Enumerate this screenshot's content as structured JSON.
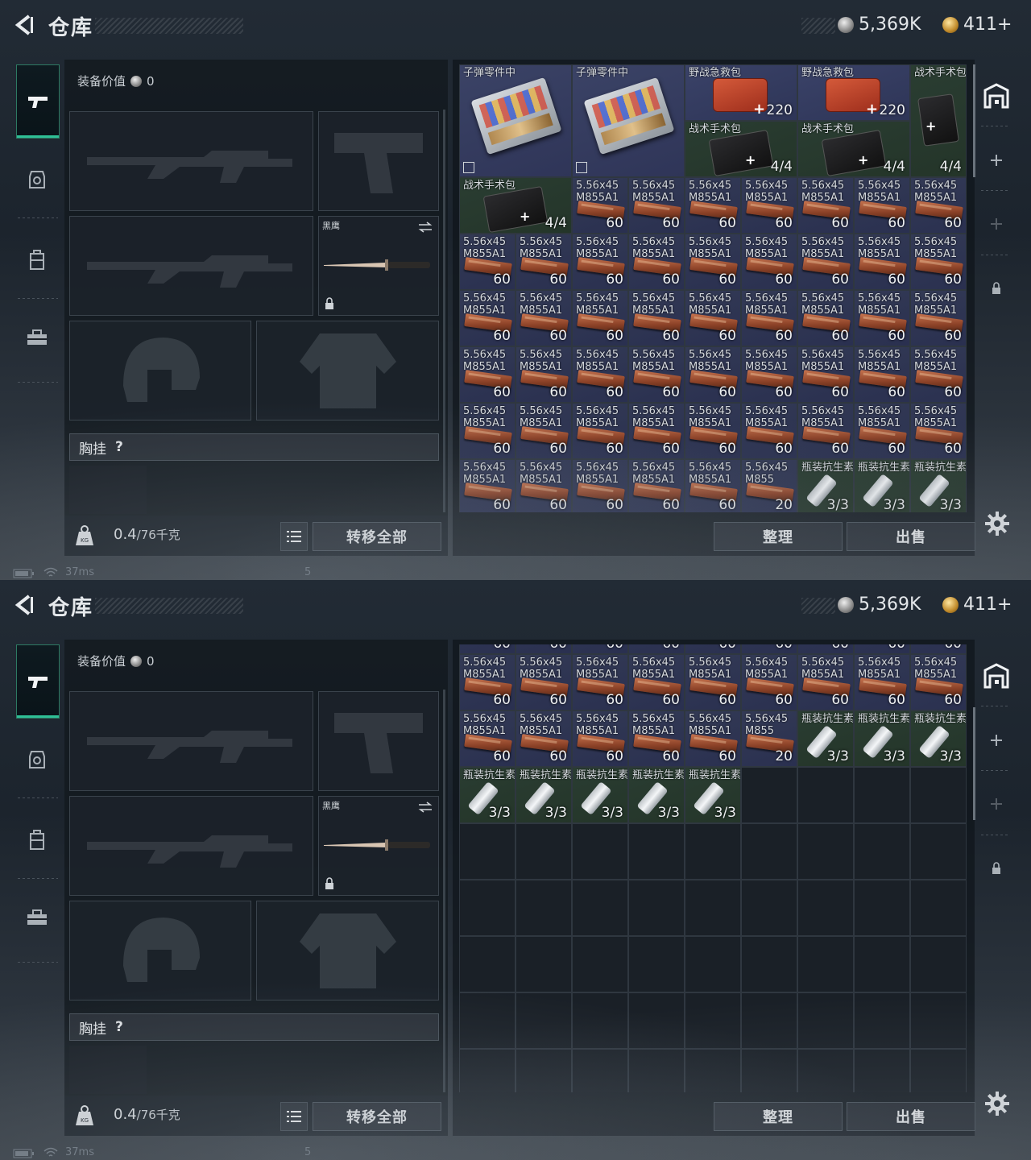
{
  "screens": [
    {
      "topbar": {
        "title": "仓库",
        "silver": "5,369K",
        "gold": "411+",
        "gold_plus": "+"
      },
      "equipment": {
        "value_label": "装备价值",
        "value": "0",
        "knife_label": "黑鹰",
        "chest_label": "胸挂",
        "help": "?"
      },
      "weight": {
        "current": "0.4",
        "max": "/76千克"
      },
      "buttons": {
        "transfer_all": "转移全部",
        "sort": "整理",
        "sell": "出售"
      },
      "status": {
        "ping": "37ms",
        "num": "5"
      },
      "grid": {
        "items": [
          {
            "c": 0,
            "r": 0,
            "w": 2,
            "h": 2,
            "type": "ammobox",
            "name": "子弹零件中",
            "count": ""
          },
          {
            "c": 2,
            "r": 0,
            "w": 2,
            "h": 2,
            "type": "ammobox",
            "name": "子弹零件中",
            "count": ""
          },
          {
            "c": 4,
            "r": 0,
            "w": 2,
            "h": 1,
            "type": "redkit",
            "name": "野战急救包",
            "count": "220"
          },
          {
            "c": 6,
            "r": 0,
            "w": 2,
            "h": 1,
            "type": "redkit",
            "name": "野战急救包",
            "count": "220"
          },
          {
            "c": 8,
            "r": 0,
            "w": 1,
            "h": 2,
            "type": "blackkit",
            "name": "战术手术包",
            "count": "4/4"
          },
          {
            "c": 4,
            "r": 1,
            "w": 2,
            "h": 1,
            "type": "blackkit",
            "name": "战术手术包",
            "count": "4/4"
          },
          {
            "c": 6,
            "r": 1,
            "w": 2,
            "h": 1,
            "type": "blackkit",
            "name": "战术手术包",
            "count": "4/4"
          },
          {
            "c": 0,
            "r": 2,
            "w": 2,
            "h": 1,
            "type": "blackkit",
            "name": "战术手术包",
            "count": "4/4"
          },
          {
            "c": 2,
            "r": 2,
            "w": 1,
            "h": 1,
            "type": "ammo",
            "name": "5.56x45\nM855A1",
            "count": "60"
          },
          {
            "c": 3,
            "r": 2,
            "w": 1,
            "h": 1,
            "type": "ammo",
            "name": "5.56x45\nM855A1",
            "count": "60"
          },
          {
            "c": 4,
            "r": 2,
            "w": 1,
            "h": 1,
            "type": "ammo",
            "name": "5.56x45\nM855A1",
            "count": "60"
          },
          {
            "c": 5,
            "r": 2,
            "w": 1,
            "h": 1,
            "type": "ammo",
            "name": "5.56x45\nM855A1",
            "count": "60"
          },
          {
            "c": 6,
            "r": 2,
            "w": 1,
            "h": 1,
            "type": "ammo",
            "name": "5.56x45\nM855A1",
            "count": "60"
          },
          {
            "c": 7,
            "r": 2,
            "w": 1,
            "h": 1,
            "type": "ammo",
            "name": "5.56x45\nM855A1",
            "count": "60"
          },
          {
            "c": 8,
            "r": 2,
            "w": 1,
            "h": 1,
            "type": "ammo",
            "name": "5.56x45\nM855A1",
            "count": "60"
          },
          {
            "c": 0,
            "r": 3,
            "w": 1,
            "h": 1,
            "type": "ammo",
            "name": "5.56x45\nM855A1",
            "count": "60"
          },
          {
            "c": 1,
            "r": 3,
            "w": 1,
            "h": 1,
            "type": "ammo",
            "name": "5.56x45\nM855A1",
            "count": "60"
          },
          {
            "c": 2,
            "r": 3,
            "w": 1,
            "h": 1,
            "type": "ammo",
            "name": "5.56x45\nM855A1",
            "count": "60"
          },
          {
            "c": 3,
            "r": 3,
            "w": 1,
            "h": 1,
            "type": "ammo",
            "name": "5.56x45\nM855A1",
            "count": "60"
          },
          {
            "c": 4,
            "r": 3,
            "w": 1,
            "h": 1,
            "type": "ammo",
            "name": "5.56x45\nM855A1",
            "count": "60"
          },
          {
            "c": 5,
            "r": 3,
            "w": 1,
            "h": 1,
            "type": "ammo",
            "name": "5.56x45\nM855A1",
            "count": "60"
          },
          {
            "c": 6,
            "r": 3,
            "w": 1,
            "h": 1,
            "type": "ammo",
            "name": "5.56x45\nM855A1",
            "count": "60"
          },
          {
            "c": 7,
            "r": 3,
            "w": 1,
            "h": 1,
            "type": "ammo",
            "name": "5.56x45\nM855A1",
            "count": "60"
          },
          {
            "c": 8,
            "r": 3,
            "w": 1,
            "h": 1,
            "type": "ammo",
            "name": "5.56x45\nM855A1",
            "count": "60"
          },
          {
            "c": 0,
            "r": 4,
            "w": 1,
            "h": 1,
            "type": "ammo",
            "name": "5.56x45\nM855A1",
            "count": "60"
          },
          {
            "c": 1,
            "r": 4,
            "w": 1,
            "h": 1,
            "type": "ammo",
            "name": "5.56x45\nM855A1",
            "count": "60"
          },
          {
            "c": 2,
            "r": 4,
            "w": 1,
            "h": 1,
            "type": "ammo",
            "name": "5.56x45\nM855A1",
            "count": "60"
          },
          {
            "c": 3,
            "r": 4,
            "w": 1,
            "h": 1,
            "type": "ammo",
            "name": "5.56x45\nM855A1",
            "count": "60"
          },
          {
            "c": 4,
            "r": 4,
            "w": 1,
            "h": 1,
            "type": "ammo",
            "name": "5.56x45\nM855A1",
            "count": "60"
          },
          {
            "c": 5,
            "r": 4,
            "w": 1,
            "h": 1,
            "type": "ammo",
            "name": "5.56x45\nM855A1",
            "count": "60"
          },
          {
            "c": 6,
            "r": 4,
            "w": 1,
            "h": 1,
            "type": "ammo",
            "name": "5.56x45\nM855A1",
            "count": "60"
          },
          {
            "c": 7,
            "r": 4,
            "w": 1,
            "h": 1,
            "type": "ammo",
            "name": "5.56x45\nM855A1",
            "count": "60"
          },
          {
            "c": 8,
            "r": 4,
            "w": 1,
            "h": 1,
            "type": "ammo",
            "name": "5.56x45\nM855A1",
            "count": "60"
          },
          {
            "c": 0,
            "r": 5,
            "w": 1,
            "h": 1,
            "type": "ammo",
            "name": "5.56x45\nM855A1",
            "count": "60"
          },
          {
            "c": 1,
            "r": 5,
            "w": 1,
            "h": 1,
            "type": "ammo",
            "name": "5.56x45\nM855A1",
            "count": "60"
          },
          {
            "c": 2,
            "r": 5,
            "w": 1,
            "h": 1,
            "type": "ammo",
            "name": "5.56x45\nM855A1",
            "count": "60"
          },
          {
            "c": 3,
            "r": 5,
            "w": 1,
            "h": 1,
            "type": "ammo",
            "name": "5.56x45\nM855A1",
            "count": "60"
          },
          {
            "c": 4,
            "r": 5,
            "w": 1,
            "h": 1,
            "type": "ammo",
            "name": "5.56x45\nM855A1",
            "count": "60"
          },
          {
            "c": 5,
            "r": 5,
            "w": 1,
            "h": 1,
            "type": "ammo",
            "name": "5.56x45\nM855A1",
            "count": "60"
          },
          {
            "c": 6,
            "r": 5,
            "w": 1,
            "h": 1,
            "type": "ammo",
            "name": "5.56x45\nM855A1",
            "count": "60"
          },
          {
            "c": 7,
            "r": 5,
            "w": 1,
            "h": 1,
            "type": "ammo",
            "name": "5.56x45\nM855A1",
            "count": "60"
          },
          {
            "c": 8,
            "r": 5,
            "w": 1,
            "h": 1,
            "type": "ammo",
            "name": "5.56x45\nM855A1",
            "count": "60"
          },
          {
            "c": 0,
            "r": 6,
            "w": 1,
            "h": 1,
            "type": "ammo",
            "name": "5.56x45\nM855A1",
            "count": "60"
          },
          {
            "c": 1,
            "r": 6,
            "w": 1,
            "h": 1,
            "type": "ammo",
            "name": "5.56x45\nM855A1",
            "count": "60"
          },
          {
            "c": 2,
            "r": 6,
            "w": 1,
            "h": 1,
            "type": "ammo",
            "name": "5.56x45\nM855A1",
            "count": "60"
          },
          {
            "c": 3,
            "r": 6,
            "w": 1,
            "h": 1,
            "type": "ammo",
            "name": "5.56x45\nM855A1",
            "count": "60"
          },
          {
            "c": 4,
            "r": 6,
            "w": 1,
            "h": 1,
            "type": "ammo",
            "name": "5.56x45\nM855A1",
            "count": "60"
          },
          {
            "c": 5,
            "r": 6,
            "w": 1,
            "h": 1,
            "type": "ammo",
            "name": "5.56x45\nM855A1",
            "count": "60"
          },
          {
            "c": 6,
            "r": 6,
            "w": 1,
            "h": 1,
            "type": "ammo",
            "name": "5.56x45\nM855A1",
            "count": "60"
          },
          {
            "c": 7,
            "r": 6,
            "w": 1,
            "h": 1,
            "type": "ammo",
            "name": "5.56x45\nM855A1",
            "count": "60"
          },
          {
            "c": 8,
            "r": 6,
            "w": 1,
            "h": 1,
            "type": "ammo",
            "name": "5.56x45\nM855A1",
            "count": "60"
          },
          {
            "c": 0,
            "r": 7,
            "w": 1,
            "h": 1,
            "type": "ammo",
            "name": "5.56x45\nM855A1",
            "count": "60"
          },
          {
            "c": 1,
            "r": 7,
            "w": 1,
            "h": 1,
            "type": "ammo",
            "name": "5.56x45\nM855A1",
            "count": "60"
          },
          {
            "c": 2,
            "r": 7,
            "w": 1,
            "h": 1,
            "type": "ammo",
            "name": "5.56x45\nM855A1",
            "count": "60"
          },
          {
            "c": 3,
            "r": 7,
            "w": 1,
            "h": 1,
            "type": "ammo",
            "name": "5.56x45\nM855A1",
            "count": "60"
          },
          {
            "c": 4,
            "r": 7,
            "w": 1,
            "h": 1,
            "type": "ammo",
            "name": "5.56x45\nM855A1",
            "count": "60"
          },
          {
            "c": 5,
            "r": 7,
            "w": 1,
            "h": 1,
            "type": "ammoalt",
            "name": "5.56x45\nM855",
            "count": "20"
          },
          {
            "c": 6,
            "r": 7,
            "w": 1,
            "h": 1,
            "type": "vial",
            "name": "瓶装抗生素",
            "count": "3/3"
          },
          {
            "c": 7,
            "r": 7,
            "w": 1,
            "h": 1,
            "type": "vial",
            "name": "瓶装抗生素",
            "count": "3/3"
          },
          {
            "c": 8,
            "r": 7,
            "w": 1,
            "h": 1,
            "type": "vial",
            "name": "瓶装抗生素",
            "count": "3/3"
          }
        ]
      }
    },
    {
      "topbar": {
        "title": "仓库",
        "silver": "5,369K",
        "gold": "411+",
        "gold_plus": "+"
      },
      "equipment": {
        "value_label": "装备价值",
        "value": "0",
        "knife_label": "黑鹰",
        "chest_label": "胸挂",
        "help": "?"
      },
      "weight": {
        "current": "0.4",
        "max": "/76千克"
      },
      "buttons": {
        "transfer_all": "转移全部",
        "sort": "整理",
        "sell": "出售"
      },
      "status": {
        "ping": "37ms",
        "num": "5"
      },
      "grid": {
        "items": [
          {
            "c": 0,
            "r": -1,
            "w": 1,
            "h": 1,
            "type": "ammo",
            "name": "",
            "count": "60"
          },
          {
            "c": 1,
            "r": -1,
            "w": 1,
            "h": 1,
            "type": "ammo",
            "name": "",
            "count": "60"
          },
          {
            "c": 2,
            "r": -1,
            "w": 1,
            "h": 1,
            "type": "ammo",
            "name": "",
            "count": "60"
          },
          {
            "c": 3,
            "r": -1,
            "w": 1,
            "h": 1,
            "type": "ammo",
            "name": "",
            "count": "60"
          },
          {
            "c": 4,
            "r": -1,
            "w": 1,
            "h": 1,
            "type": "ammo",
            "name": "",
            "count": "60"
          },
          {
            "c": 5,
            "r": -1,
            "w": 1,
            "h": 1,
            "type": "ammo",
            "name": "",
            "count": "60"
          },
          {
            "c": 6,
            "r": -1,
            "w": 1,
            "h": 1,
            "type": "ammo",
            "name": "",
            "count": "60"
          },
          {
            "c": 7,
            "r": -1,
            "w": 1,
            "h": 1,
            "type": "ammo",
            "name": "",
            "count": "60"
          },
          {
            "c": 8,
            "r": -1,
            "w": 1,
            "h": 1,
            "type": "ammo",
            "name": "",
            "count": "60"
          },
          {
            "c": 0,
            "r": 0,
            "w": 1,
            "h": 1,
            "type": "ammo",
            "name": "5.56x45\nM855A1",
            "count": "60"
          },
          {
            "c": 1,
            "r": 0,
            "w": 1,
            "h": 1,
            "type": "ammo",
            "name": "5.56x45\nM855A1",
            "count": "60"
          },
          {
            "c": 2,
            "r": 0,
            "w": 1,
            "h": 1,
            "type": "ammo",
            "name": "5.56x45\nM855A1",
            "count": "60"
          },
          {
            "c": 3,
            "r": 0,
            "w": 1,
            "h": 1,
            "type": "ammo",
            "name": "5.56x45\nM855A1",
            "count": "60"
          },
          {
            "c": 4,
            "r": 0,
            "w": 1,
            "h": 1,
            "type": "ammo",
            "name": "5.56x45\nM855A1",
            "count": "60"
          },
          {
            "c": 5,
            "r": 0,
            "w": 1,
            "h": 1,
            "type": "ammo",
            "name": "5.56x45\nM855A1",
            "count": "60"
          },
          {
            "c": 6,
            "r": 0,
            "w": 1,
            "h": 1,
            "type": "ammo",
            "name": "5.56x45\nM855A1",
            "count": "60"
          },
          {
            "c": 7,
            "r": 0,
            "w": 1,
            "h": 1,
            "type": "ammo",
            "name": "5.56x45\nM855A1",
            "count": "60"
          },
          {
            "c": 8,
            "r": 0,
            "w": 1,
            "h": 1,
            "type": "ammo",
            "name": "5.56x45\nM855A1",
            "count": "60"
          },
          {
            "c": 0,
            "r": 1,
            "w": 1,
            "h": 1,
            "type": "ammo",
            "name": "5.56x45\nM855A1",
            "count": "60"
          },
          {
            "c": 1,
            "r": 1,
            "w": 1,
            "h": 1,
            "type": "ammo",
            "name": "5.56x45\nM855A1",
            "count": "60"
          },
          {
            "c": 2,
            "r": 1,
            "w": 1,
            "h": 1,
            "type": "ammo",
            "name": "5.56x45\nM855A1",
            "count": "60"
          },
          {
            "c": 3,
            "r": 1,
            "w": 1,
            "h": 1,
            "type": "ammo",
            "name": "5.56x45\nM855A1",
            "count": "60"
          },
          {
            "c": 4,
            "r": 1,
            "w": 1,
            "h": 1,
            "type": "ammo",
            "name": "5.56x45\nM855A1",
            "count": "60"
          },
          {
            "c": 5,
            "r": 1,
            "w": 1,
            "h": 1,
            "type": "ammoalt",
            "name": "5.56x45\nM855",
            "count": "20"
          },
          {
            "c": 6,
            "r": 1,
            "w": 1,
            "h": 1,
            "type": "vial",
            "name": "瓶装抗生素",
            "count": "3/3"
          },
          {
            "c": 7,
            "r": 1,
            "w": 1,
            "h": 1,
            "type": "vial",
            "name": "瓶装抗生素",
            "count": "3/3"
          },
          {
            "c": 8,
            "r": 1,
            "w": 1,
            "h": 1,
            "type": "vial",
            "name": "瓶装抗生素",
            "count": "3/3"
          },
          {
            "c": 0,
            "r": 2,
            "w": 1,
            "h": 1,
            "type": "vial",
            "name": "瓶装抗生素",
            "count": "3/3"
          },
          {
            "c": 1,
            "r": 2,
            "w": 1,
            "h": 1,
            "type": "vial",
            "name": "瓶装抗生素",
            "count": "3/3"
          },
          {
            "c": 2,
            "r": 2,
            "w": 1,
            "h": 1,
            "type": "vial",
            "name": "瓶装抗生素",
            "count": "3/3"
          },
          {
            "c": 3,
            "r": 2,
            "w": 1,
            "h": 1,
            "type": "vial",
            "name": "瓶装抗生素",
            "count": "3/3"
          },
          {
            "c": 4,
            "r": 2,
            "w": 1,
            "h": 1,
            "type": "vial",
            "name": "瓶装抗生素",
            "count": "3/3"
          }
        ]
      }
    }
  ]
}
